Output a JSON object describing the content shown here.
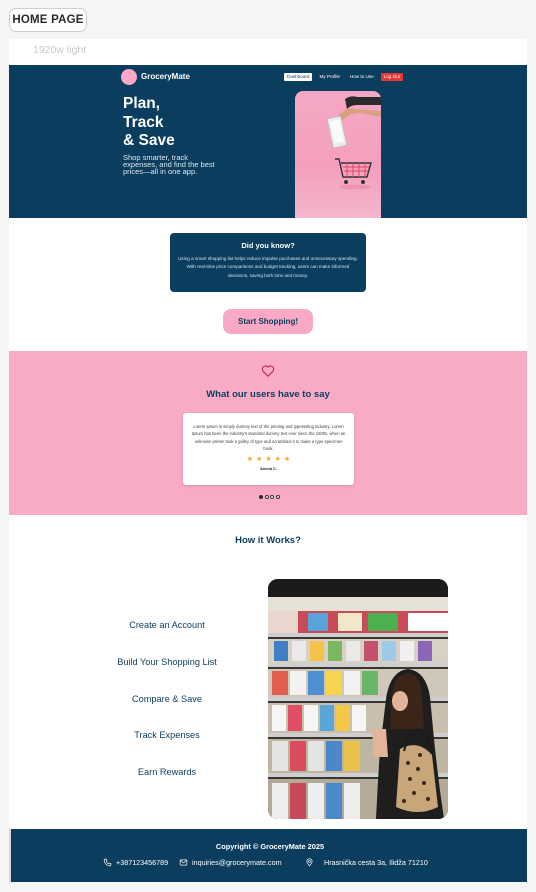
{
  "page": {
    "tag": "HOME PAGE",
    "frame_label": "1920w light"
  },
  "header": {
    "brand": "GroceryMate",
    "nav": [
      "Dashboard",
      "My Profile",
      "How to Use",
      "Log Out"
    ]
  },
  "hero": {
    "title_lines": [
      "Plan,",
      "Track",
      "& Save"
    ],
    "subtitle": "Shop smarter, track expenses, and find the best prices—all in one app."
  },
  "did_you_know": {
    "title": "Did you know?",
    "body": "Using a smart shopping list helps reduce impulse purchases and unnecessary spending. With real-time price comparisons and budget tracking, users can make informed decisions, saving both time and money."
  },
  "cta": "Start Shopping!",
  "testimonials": {
    "title": "What our users have to say",
    "quote": "Lorem Ipsum is simply dummy text of the printing and typesetting industry. Lorem Ipsum has been the industry's standard dummy text ever since the 1500s, when an unknown printer took a galley of type and scrambled it to make a type specimen book.",
    "rating": 5,
    "author": "Amela C.",
    "dots": 4,
    "active_dot": 0
  },
  "how": {
    "title": "How it Works?",
    "steps": [
      "Create an Account",
      "Build Your Shopping List",
      "Compare & Save",
      "Track Expenses",
      "Earn Rewards"
    ]
  },
  "footer": {
    "copyright": "Copyright © GroceryMate 2025",
    "phone": "+387123456789",
    "email": "inquiries@grocerymate.com",
    "address": "Hrasnička cesta 3a, Ilidža 71210"
  },
  "colors": {
    "navy": "#0a3d5e",
    "pink": "#f9a8c6",
    "star": "#f5a623",
    "logout": "#e53935"
  }
}
